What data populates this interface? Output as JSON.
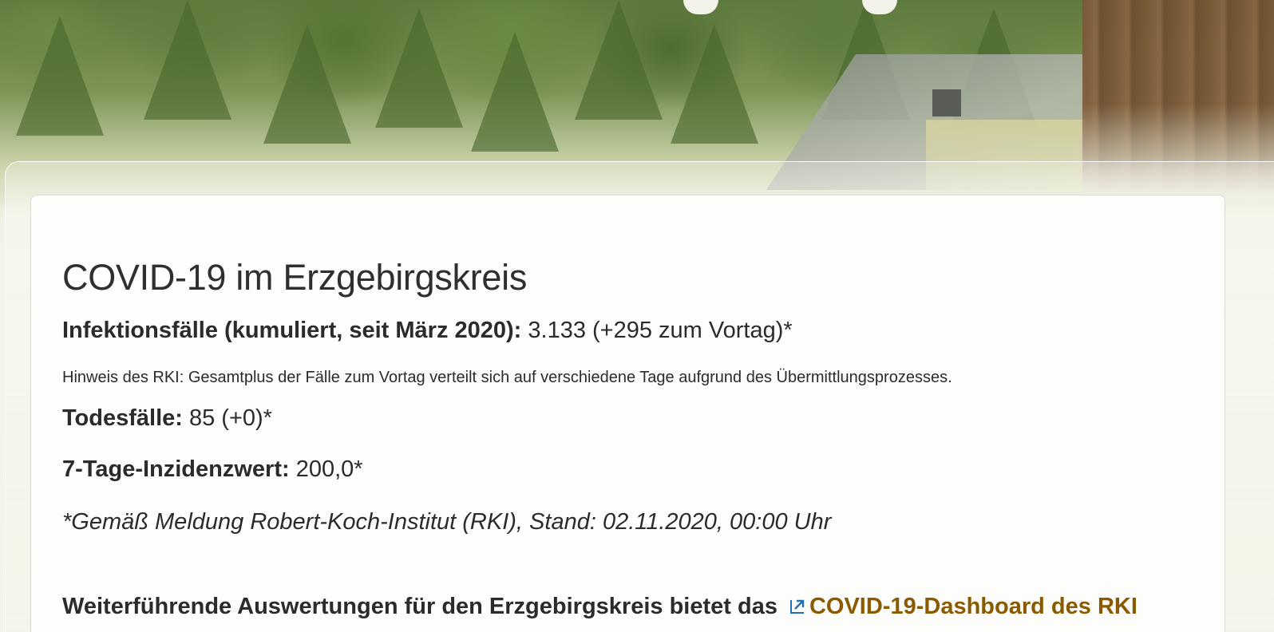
{
  "page": {
    "title": "COVID-19 im Erzgebirgskreis"
  },
  "stats": {
    "infections_label": "Infektionsfälle (kumuliert, seit März 2020):",
    "infections_value": " 3.133 (+295 zum Vortag)*",
    "hint": "Hinweis des RKI: Gesamtplus der Fälle zum Vortag verteilt sich auf verschiedene Tage aufgrund des Übermittlungsprozesses.",
    "deaths_label": "Todesfälle:",
    "deaths_value": " 85 (+0)*",
    "incidence_label": "7-Tage-Inzidenzwert:",
    "incidence_value": " 200,0*",
    "source_note": "*Gemäß Meldung Robert-Koch-Institut (RKI), Stand: 02.11.2020, 00:00 Uhr"
  },
  "further": {
    "text": "Weiterführende Auswertungen für den Erzgebirgskreis bietet das",
    "link_label": "COVID-19-Dashboard des RKI"
  },
  "colors": {
    "link": "#8a5a00",
    "icon": "#1f6fb5",
    "card_bg": "#fdfdfb",
    "page_bg": "#f3f5ea"
  },
  "icons": {
    "external_link": "external-link-icon"
  }
}
